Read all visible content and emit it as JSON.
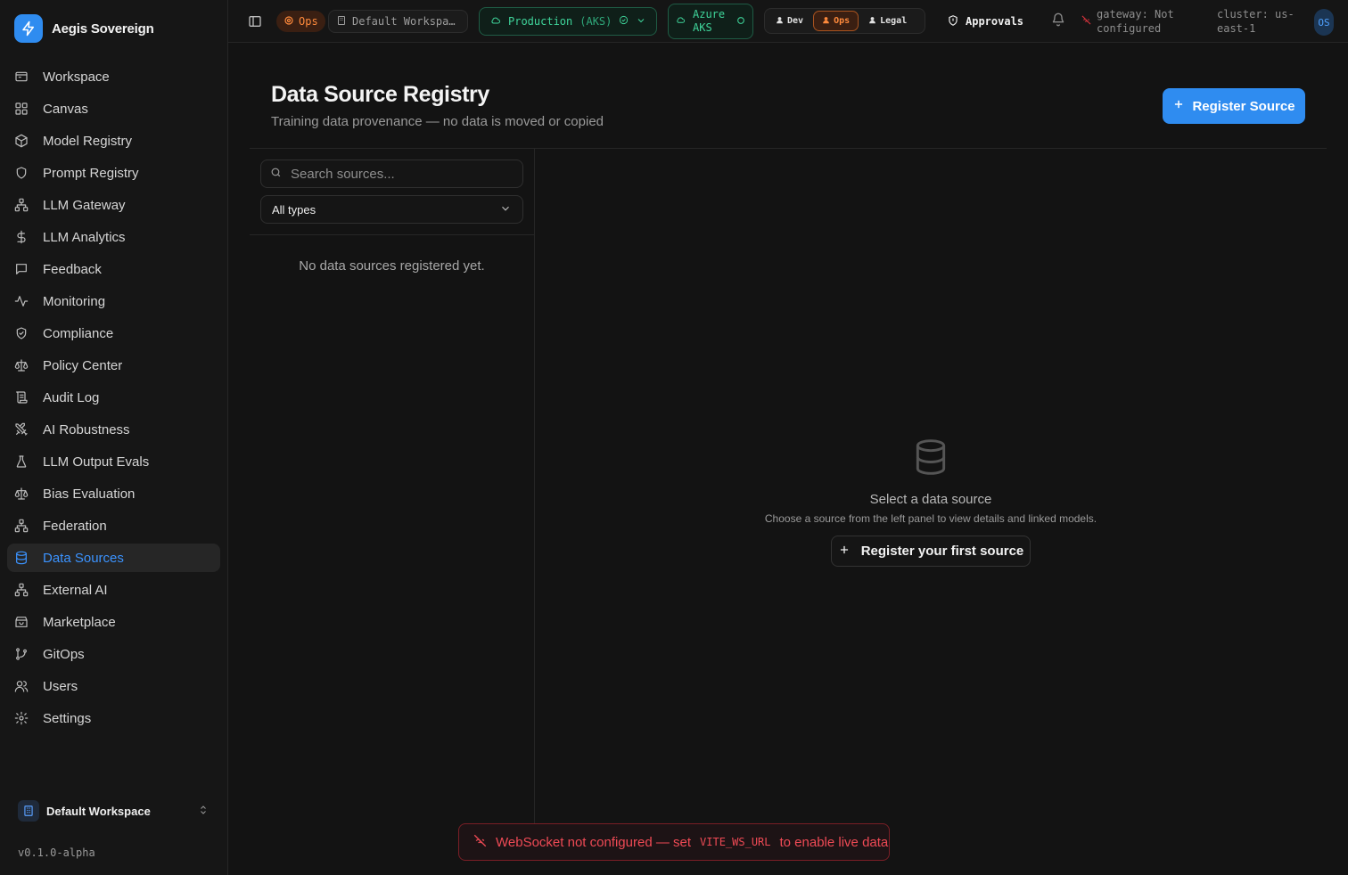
{
  "app": {
    "name": "Aegis Sovereign",
    "version": "v0.1.0-alpha"
  },
  "sidebar": {
    "items": [
      {
        "label": "Workspace",
        "icon": "workspace-icon"
      },
      {
        "label": "Canvas",
        "icon": "grid-icon"
      },
      {
        "label": "Model Registry",
        "icon": "cube-icon"
      },
      {
        "label": "Prompt Registry",
        "icon": "shield-icon"
      },
      {
        "label": "LLM Gateway",
        "icon": "network-icon"
      },
      {
        "label": "LLM Analytics",
        "icon": "dollar-icon"
      },
      {
        "label": "Feedback",
        "icon": "message-icon"
      },
      {
        "label": "Monitoring",
        "icon": "activity-icon"
      },
      {
        "label": "Compliance",
        "icon": "shield-check-icon"
      },
      {
        "label": "Policy Center",
        "icon": "scale-icon"
      },
      {
        "label": "Audit Log",
        "icon": "scroll-icon"
      },
      {
        "label": "AI Robustness",
        "icon": "swords-icon"
      },
      {
        "label": "LLM Output Evals",
        "icon": "flask-icon"
      },
      {
        "label": "Bias Evaluation",
        "icon": "scale-icon"
      },
      {
        "label": "Federation",
        "icon": "network-icon"
      },
      {
        "label": "Data Sources",
        "icon": "database-icon",
        "active": true
      },
      {
        "label": "External AI",
        "icon": "network-icon"
      },
      {
        "label": "Marketplace",
        "icon": "store-icon"
      },
      {
        "label": "GitOps",
        "icon": "git-branch-icon"
      },
      {
        "label": "Users",
        "icon": "users-icon"
      },
      {
        "label": "Settings",
        "icon": "gear-icon"
      }
    ],
    "workspace_switcher": "Default Workspace"
  },
  "topbar": {
    "role_badge": "Ops",
    "workspace": "Default Workspa…",
    "environment": "Production",
    "environment_suffix": "(AKS)",
    "cloud_line1": "Azure",
    "cloud_line2": "AKS",
    "roles": [
      {
        "label": "Dev",
        "active": false
      },
      {
        "label": "Ops",
        "active": true
      },
      {
        "label": "Legal",
        "active": false
      }
    ],
    "approvals": "Approvals",
    "gateway_status": "gateway: Not configured",
    "cluster": "cluster: us-east-1",
    "avatar": "OS"
  },
  "page": {
    "title": "Data Source Registry",
    "subtitle": "Training data provenance — no data is moved or copied",
    "register_button": "Register Source"
  },
  "left_panel": {
    "search_placeholder": "Search sources...",
    "type_filter": "All types",
    "empty_text": "No data sources registered yet."
  },
  "empty_state": {
    "title": "Select a data source",
    "subtitle": "Choose a source from the left panel to view details and linked models.",
    "button": "Register your first source"
  },
  "toast": {
    "text_before": "WebSocket not configured — set",
    "code": "VITE_WS_URL",
    "text_after": "to enable live data"
  },
  "colors": {
    "accent": "#2f8cf0",
    "ops": "#ff8a3c",
    "env": "#3fd49a",
    "error": "#ef4a55"
  }
}
